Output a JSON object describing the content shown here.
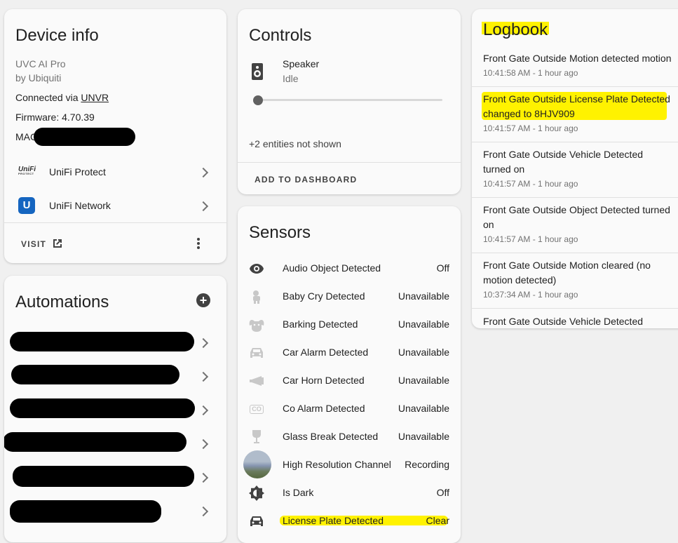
{
  "device_info": {
    "title": "Device info",
    "model": "UVC AI Pro",
    "manufacturer": "by Ubiquiti",
    "connected_prefix": "Connected via ",
    "connected_link": "UNVR",
    "firmware": "Firmware: 4.70.39",
    "mac_prefix": "MAC",
    "integrations": [
      {
        "label": "UniFi Protect",
        "icon": "unifi-protect-logo"
      },
      {
        "label": "UniFi Network",
        "icon": "unifi-network-logo"
      }
    ],
    "visit_label": "VISIT"
  },
  "automations": {
    "title": "Automations",
    "rows": 6
  },
  "controls": {
    "title": "Controls",
    "speaker_name": "Speaker",
    "speaker_state": "Idle",
    "volume": 0,
    "hidden_entities": "+2 entities not shown",
    "add_to_dashboard": "ADD TO DASHBOARD"
  },
  "sensors": {
    "title": "Sensors",
    "items": [
      {
        "name": "Audio Object Detected",
        "state": "Off",
        "icon": "eye-icon"
      },
      {
        "name": "Baby Cry Detected",
        "state": "Unavailable",
        "icon": "baby-icon"
      },
      {
        "name": "Barking Detected",
        "state": "Unavailable",
        "icon": "dog-icon"
      },
      {
        "name": "Car Alarm Detected",
        "state": "Unavailable",
        "icon": "car-icon"
      },
      {
        "name": "Car Horn Detected",
        "state": "Unavailable",
        "icon": "horn-icon"
      },
      {
        "name": "Co Alarm Detected",
        "state": "Unavailable",
        "icon": "co-icon"
      },
      {
        "name": "Glass Break Detected",
        "state": "Unavailable",
        "icon": "glass-icon"
      },
      {
        "name": "High Resolution Channel",
        "state": "Recording",
        "icon": "camera-thumbnail"
      },
      {
        "name": "Is Dark",
        "state": "Off",
        "icon": "brightness-icon"
      },
      {
        "name": "License Plate Detected",
        "state": "Clear",
        "icon": "car-icon"
      }
    ]
  },
  "logbook": {
    "title": "Logbook",
    "entries": [
      {
        "text": "Front Gate Outside Motion detected motion",
        "time": "10:41:58 AM - 1 hour ago"
      },
      {
        "text": "Front Gate Outside License Plate Detected changed to 8HJV909",
        "time": "10:41:57 AM - 1 hour ago"
      },
      {
        "text": "Front Gate Outside Vehicle Detected turned on",
        "time": "10:41:57 AM - 1 hour ago"
      },
      {
        "text": "Front Gate Outside Object Detected turned on",
        "time": "10:41:57 AM - 1 hour ago"
      },
      {
        "text": "Front Gate Outside Motion cleared (no motion detected)",
        "time": "10:37:34 AM - 1 hour ago"
      },
      {
        "text": "Front Gate Outside Vehicle Detected turned",
        "time": ""
      }
    ]
  },
  "colors": {
    "highlight": "#fff200",
    "unifi_blue": "#1565c0"
  }
}
